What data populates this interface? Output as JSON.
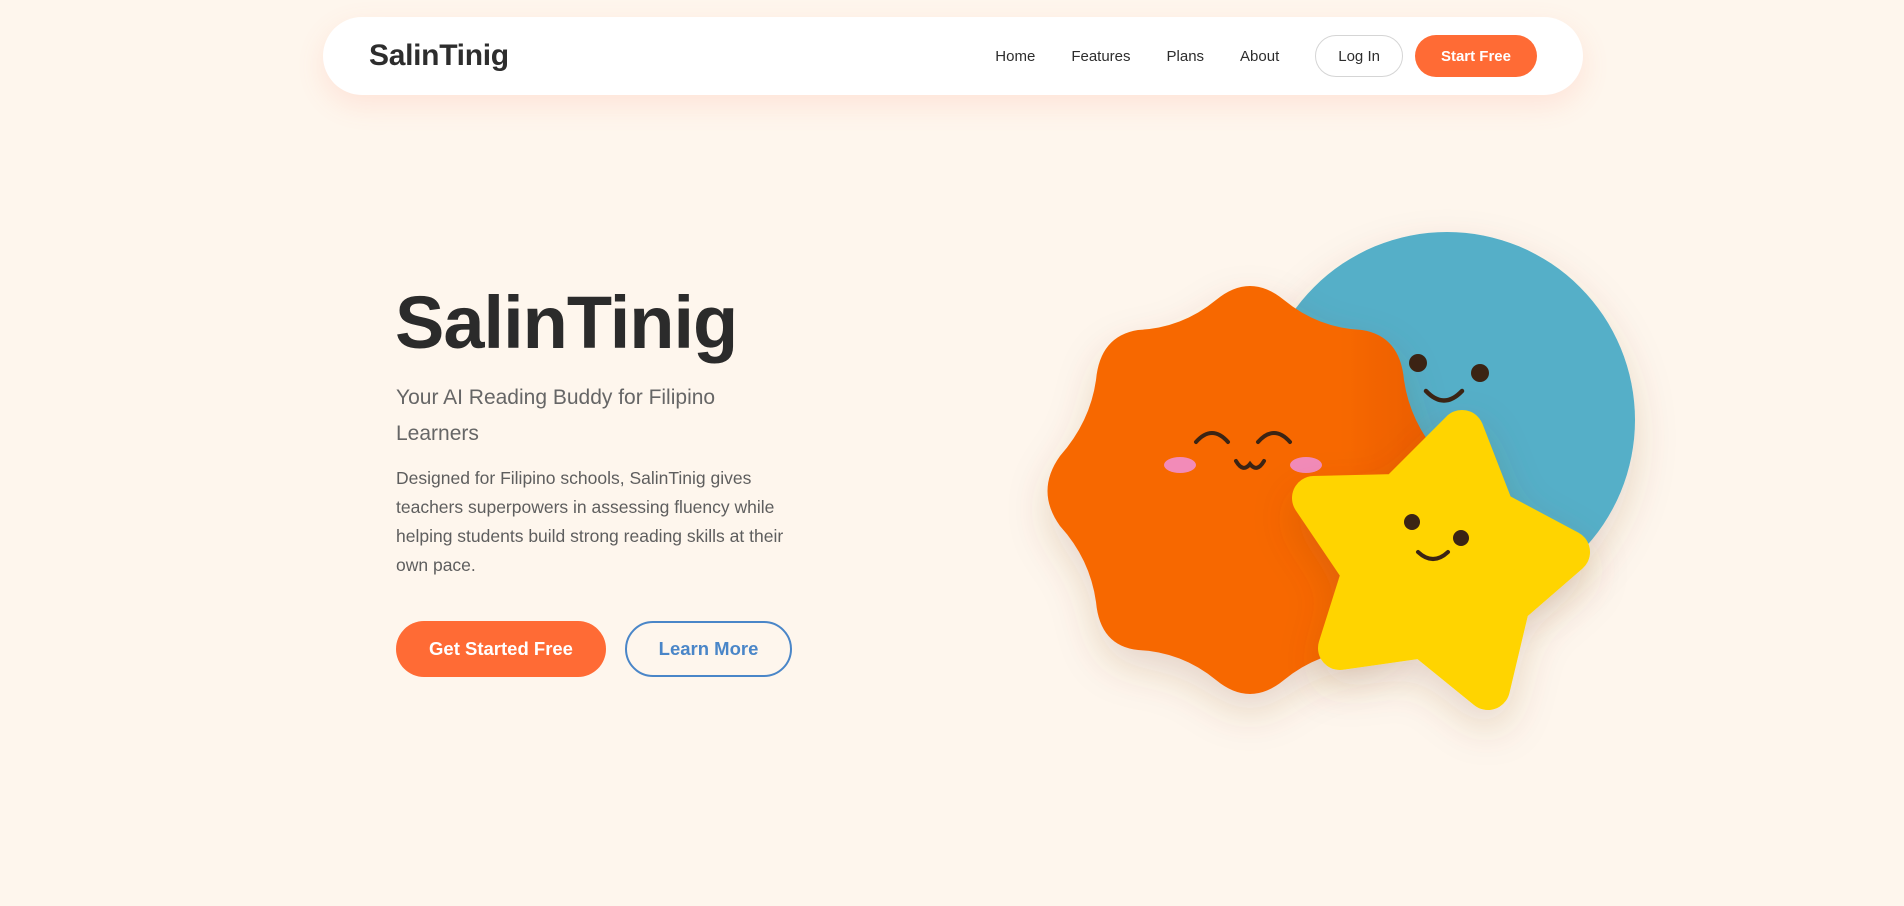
{
  "header": {
    "brand": "SalinTinig",
    "nav": [
      {
        "label": "Home"
      },
      {
        "label": "Features"
      },
      {
        "label": "Plans"
      },
      {
        "label": "About"
      }
    ],
    "login_label": "Log In",
    "start_label": "Start Free"
  },
  "hero": {
    "title": "SalinTinig",
    "subtitle": "Your AI Reading Buddy for Filipino Learners",
    "description": "Designed for Filipino schools, SalinTinig gives teachers superpowers in assessing fluency while helping students build strong reading skills at their own pace.",
    "primary_cta": "Get Started Free",
    "secondary_cta": "Learn More"
  },
  "illustration": {
    "characters": [
      {
        "name": "blue-circle-character",
        "color": "#54afc8"
      },
      {
        "name": "orange-sun-character",
        "color": "#f76806"
      },
      {
        "name": "yellow-star-character",
        "color": "#ffd400"
      }
    ],
    "cheek_color": "#f28bb8",
    "feature_color": "#3b2414"
  },
  "theme": {
    "background": "#fef6ed",
    "accent": "#ff6b35",
    "link_blue": "#4a86c8"
  }
}
